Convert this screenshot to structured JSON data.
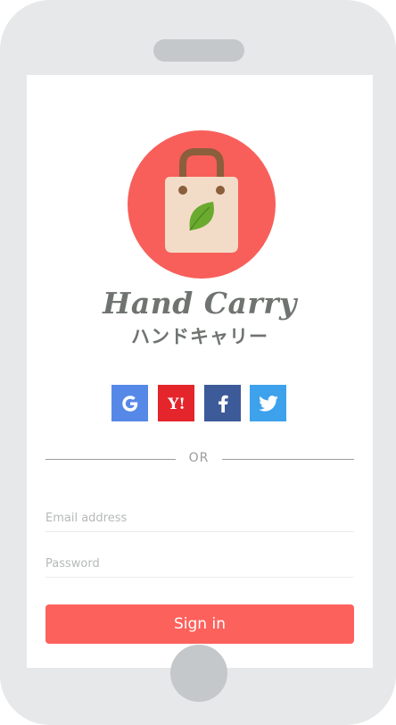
{
  "brand": {
    "name": "Hand Carry",
    "name_kana": "ハンドキャリー",
    "logo_icon": "shopping-bag-with-leaf-icon"
  },
  "social_login": [
    {
      "provider": "Google",
      "glyph": "G",
      "icon": "google-icon",
      "color": "#5688e8"
    },
    {
      "provider": "Yahoo",
      "glyph": "Y!",
      "icon": "yahoo-icon",
      "color": "#e4252b"
    },
    {
      "provider": "Facebook",
      "glyph": "f",
      "icon": "facebook-icon",
      "color": "#3d5a99"
    },
    {
      "provider": "Twitter",
      "glyph": "",
      "icon": "twitter-bird-icon",
      "color": "#3ea1ec"
    }
  ],
  "divider": {
    "label": "OR"
  },
  "form": {
    "email_placeholder": "Email address",
    "email_value": "",
    "password_placeholder": "Password",
    "password_value": "",
    "submit_label": "Sign in"
  },
  "colors": {
    "accent": "#fd615c",
    "logo_circle": "#f85f5a",
    "bag": "#f3dcc7",
    "bag_handle": "#8b5e3c",
    "leaf": "#6aaa2f",
    "text": "#6f7470"
  }
}
